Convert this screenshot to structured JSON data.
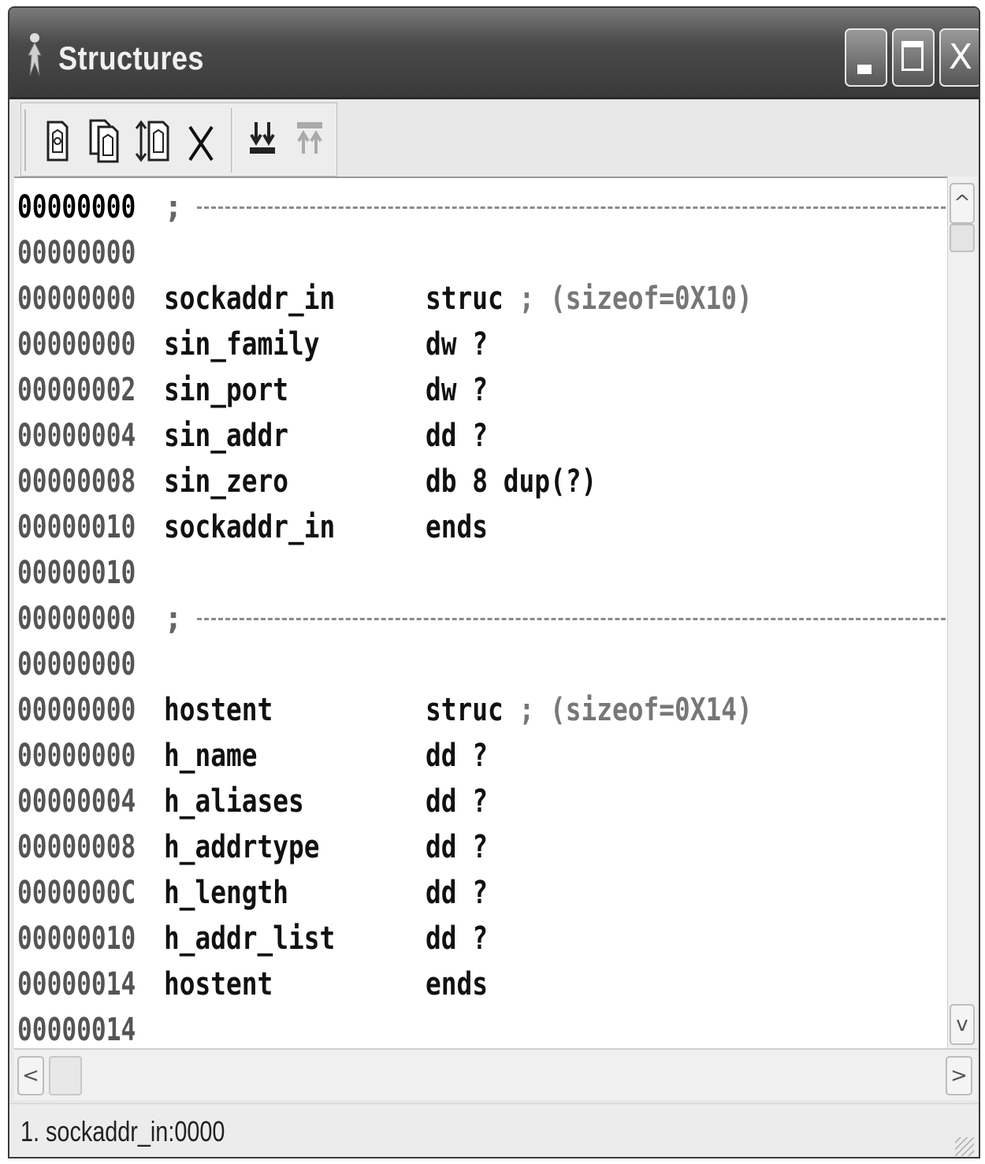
{
  "window": {
    "title": "Structures",
    "buttons": {
      "minimize": "minimize",
      "maximize": "maximize",
      "close": "X"
    }
  },
  "toolbar": {
    "icons": [
      "add-struct-icon",
      "duplicate-struct-icon",
      "expand-struct-icon",
      "delete-icon",
      "collapse-all-icon",
      "expand-all-icon"
    ],
    "delete_glyph": "X"
  },
  "listing": {
    "lines": [
      {
        "addr": "00000000",
        "kind": "separator",
        "semi": ";"
      },
      {
        "addr": "00000000",
        "kind": "blank"
      },
      {
        "addr": "00000000",
        "name": "sockaddr_in",
        "dir": "struc",
        "comment": " ; (sizeof=0X10)"
      },
      {
        "addr": "00000000",
        "name": "sin_family",
        "dir": "dw ?"
      },
      {
        "addr": "00000002",
        "name": "sin_port",
        "dir": "dw ?"
      },
      {
        "addr": "00000004",
        "name": "sin_addr",
        "dir": "dd ?"
      },
      {
        "addr": "00000008",
        "name": "sin_zero",
        "dir": "db 8 dup(?)"
      },
      {
        "addr": "00000010",
        "name": "sockaddr_in",
        "dir": "ends"
      },
      {
        "addr": "00000010",
        "kind": "blank"
      },
      {
        "addr": "00000000",
        "kind": "separator",
        "semi": ";"
      },
      {
        "addr": "00000000",
        "kind": "blank"
      },
      {
        "addr": "00000000",
        "name": "hostent",
        "dir": "struc",
        "comment": " ; (sizeof=0X14)"
      },
      {
        "addr": "00000000",
        "name": "h_name",
        "dir": "dd ?"
      },
      {
        "addr": "00000004",
        "name": "h_aliases",
        "dir": "dd ?"
      },
      {
        "addr": "00000008",
        "name": "h_addrtype",
        "dir": "dd ?"
      },
      {
        "addr": "0000000C",
        "name": "h_length",
        "dir": "dd ?"
      },
      {
        "addr": "00000010",
        "name": "h_addr_list",
        "dir": "dd ?"
      },
      {
        "addr": "00000014",
        "name": "hostent",
        "dir": "ends"
      },
      {
        "addr": "00000014",
        "kind": "blank"
      }
    ]
  },
  "scrollbars": {
    "up": "^",
    "down": "v",
    "left": "<",
    "right": ">"
  },
  "status": {
    "text": "1. sockaddr_in:0000"
  }
}
